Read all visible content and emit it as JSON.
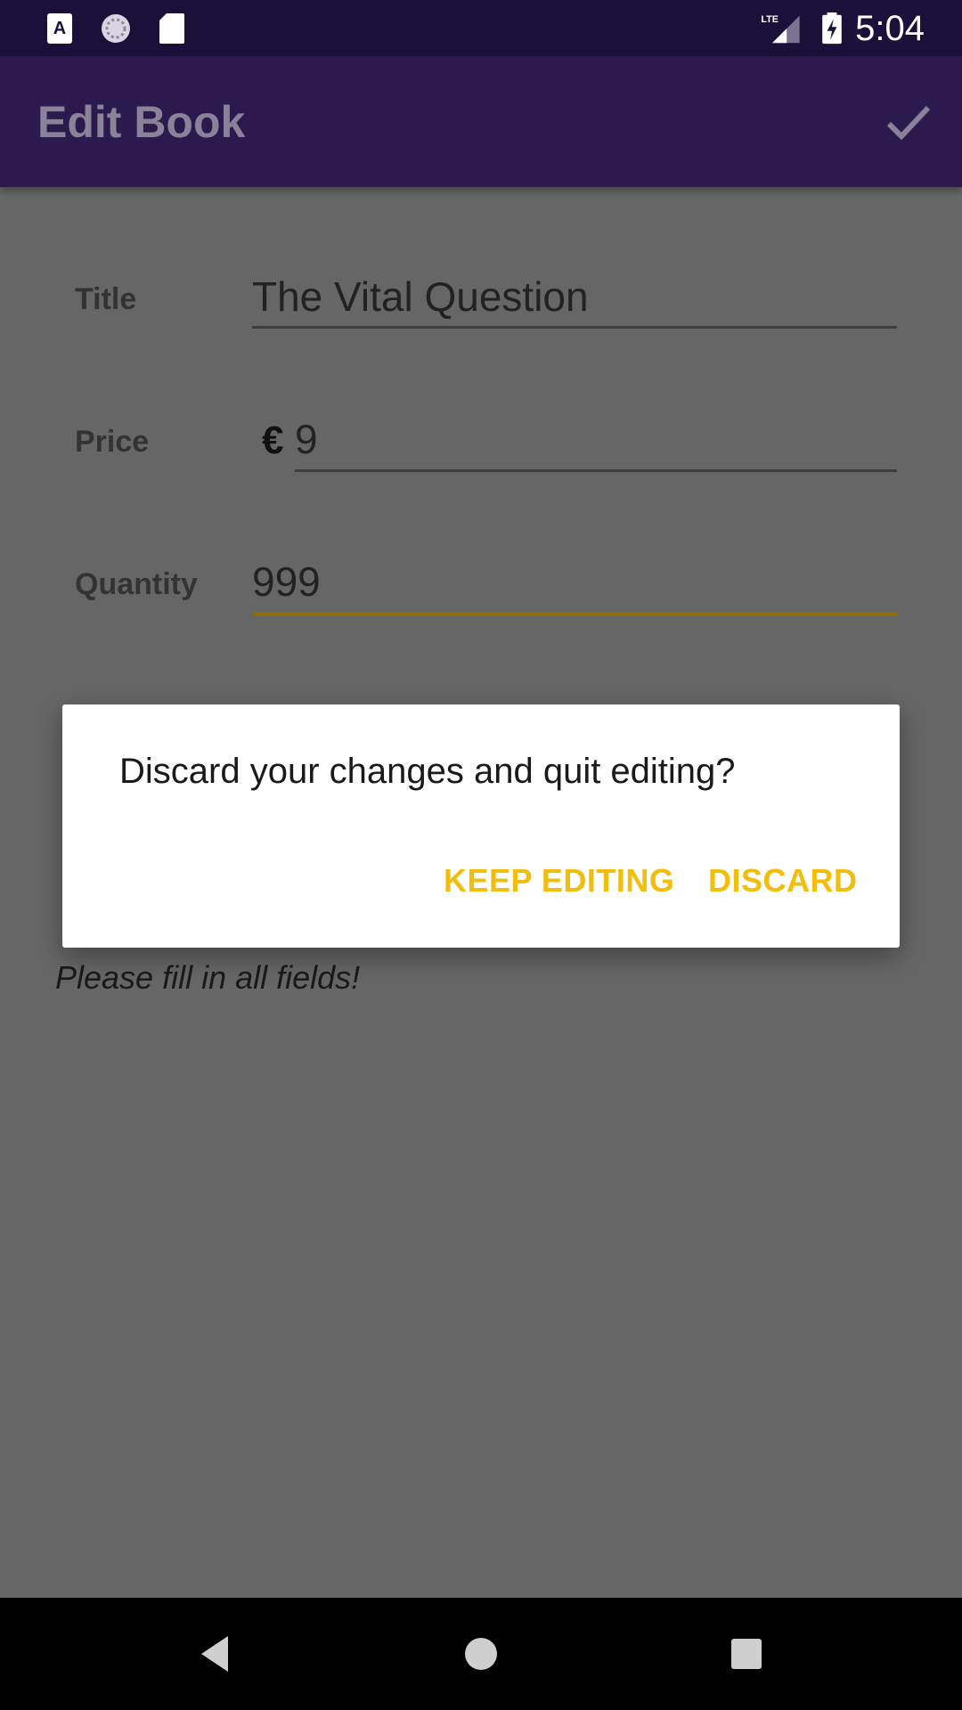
{
  "status_bar": {
    "time": "5:04",
    "left_icons": [
      "text-icon",
      "sync-icon",
      "sd-card-icon"
    ],
    "right_icons": [
      "lte-signal-icon",
      "battery-charging-icon"
    ],
    "network_label": "LTE"
  },
  "app_bar": {
    "title": "Edit Book",
    "save_icon": "check-icon"
  },
  "form": {
    "title": {
      "label": "Title",
      "value": "The Vital Question"
    },
    "price": {
      "label": "Price",
      "currency": "€",
      "value": "9"
    },
    "quantity": {
      "label": "Quantity",
      "value": "999"
    },
    "hint": "Please fill in all fields!"
  },
  "dialog": {
    "message": "Discard your changes and quit editing?",
    "keep_label": "KEEP EDITING",
    "discard_label": "DISCARD"
  },
  "nav_bar": {
    "icons": [
      "back-icon",
      "home-icon",
      "recents-icon"
    ]
  },
  "colors": {
    "status_bar": "#1b1039",
    "app_bar": "#2c1a4e",
    "scrim_background": "#666666",
    "accent": "#f2bd0b",
    "active_underline": "#8a6d0c"
  }
}
